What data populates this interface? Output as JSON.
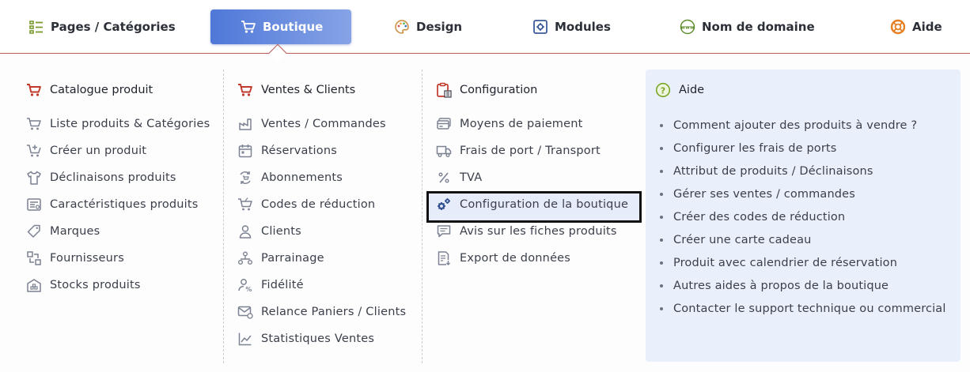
{
  "nav": {
    "items": [
      {
        "label": "Pages / Catégories",
        "icon": "list-icon"
      },
      {
        "label": "Boutique",
        "icon": "cart-icon"
      },
      {
        "label": "Design",
        "icon": "palette-icon"
      },
      {
        "label": "Modules",
        "icon": "module-icon"
      },
      {
        "label": "Nom de domaine",
        "icon": "www-icon"
      },
      {
        "label": "Aide",
        "icon": "lifebuoy-icon"
      }
    ],
    "active_index": 1
  },
  "catalogue": {
    "title": "Catalogue produit",
    "links": [
      {
        "label": "Liste produits & Catégories",
        "icon": "cart-icon"
      },
      {
        "label": "Créer un produit",
        "icon": "cart-add-icon"
      },
      {
        "label": "Déclinaisons produits",
        "icon": "tshirt-icon"
      },
      {
        "label": "Caractéristiques produits",
        "icon": "list-detail-icon"
      },
      {
        "label": "Marques",
        "icon": "tag-icon"
      },
      {
        "label": "Fournisseurs",
        "icon": "supplier-icon"
      },
      {
        "label": "Stocks produits",
        "icon": "warehouse-icon"
      }
    ]
  },
  "ventes": {
    "title": "Ventes & Clients",
    "links": [
      {
        "label": "Ventes / Commandes",
        "icon": "sales-icon"
      },
      {
        "label": "Réservations",
        "icon": "calendar-icon"
      },
      {
        "label": "Abonnements",
        "icon": "subscription-icon"
      },
      {
        "label": "Codes de réduction",
        "icon": "discount-icon"
      },
      {
        "label": "Clients",
        "icon": "user-icon"
      },
      {
        "label": "Parrainage",
        "icon": "referral-icon"
      },
      {
        "label": "Fidélité",
        "icon": "loyalty-icon"
      },
      {
        "label": "Relance Paniers / Clients",
        "icon": "mail-icon"
      },
      {
        "label": "Statistiques Ventes",
        "icon": "chart-icon"
      }
    ]
  },
  "configuration": {
    "title": "Configuration",
    "links": [
      {
        "label": "Moyens de paiement",
        "icon": "payment-icon"
      },
      {
        "label": "Frais de port / Transport",
        "icon": "truck-icon"
      },
      {
        "label": "TVA",
        "icon": "percent-icon"
      },
      {
        "label": "Configuration de la boutique",
        "icon": "gears-icon"
      },
      {
        "label": "Avis sur les fiches produits",
        "icon": "review-icon"
      },
      {
        "label": "Export de données",
        "icon": "export-icon"
      }
    ]
  },
  "help": {
    "title": "Aide",
    "items": [
      "Comment ajouter des produits à vendre ?",
      "Configurer les frais de ports",
      "Attribut de produits / Déclinaisons",
      "Gérer ses ventes / commandes",
      "Créer des codes de réduction",
      "Créer une carte cadeau",
      "Produit avec calendrier de réservation",
      "Autres aides à propos de la boutique",
      "Contacter le support technique ou commercial"
    ]
  },
  "colors": {
    "accent": "#4f78d8",
    "title_icon_red": "#c0392b",
    "link_icon_gray": "#7b8291",
    "help_bg": "#eaf0fb"
  }
}
